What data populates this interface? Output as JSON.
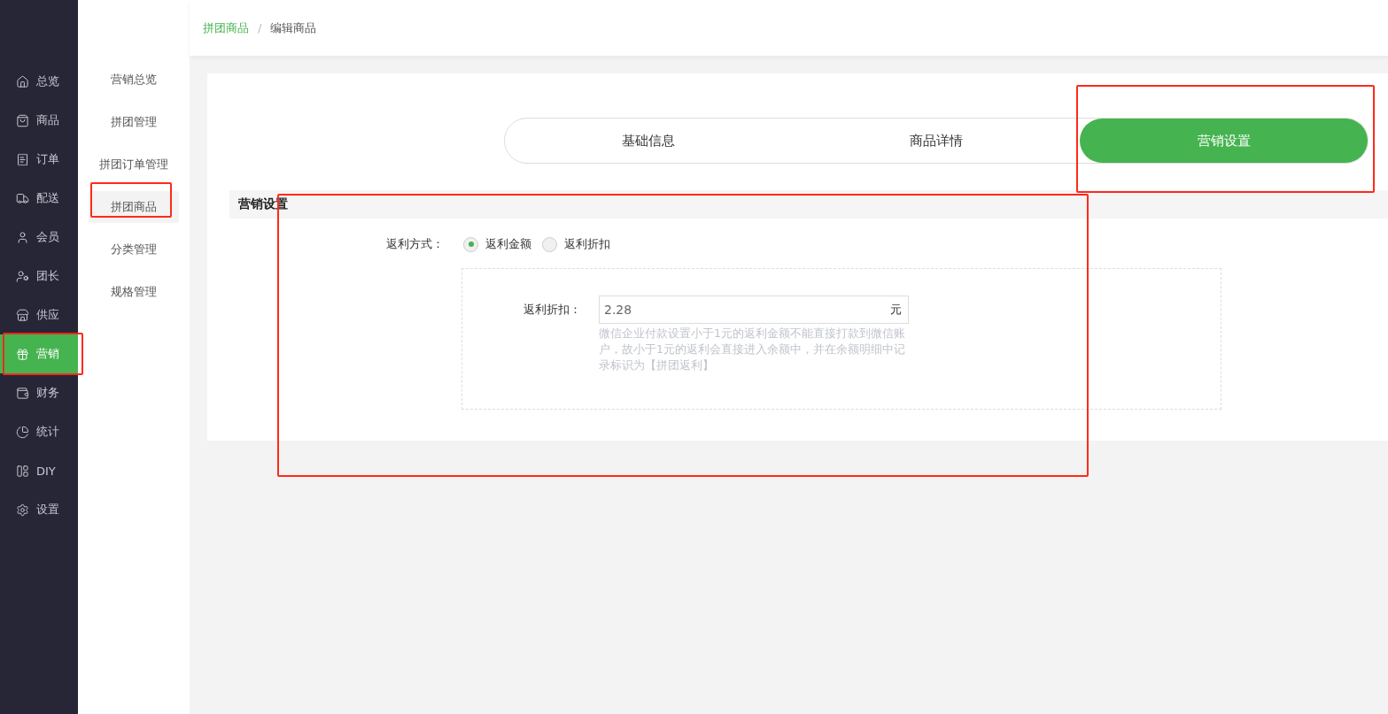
{
  "sidebar": {
    "items": [
      {
        "label": "总览",
        "selected": false,
        "highlighted": false
      },
      {
        "label": "商品",
        "selected": false,
        "highlighted": false
      },
      {
        "label": "订单",
        "selected": false,
        "highlighted": false
      },
      {
        "label": "配送",
        "selected": false,
        "highlighted": false
      },
      {
        "label": "会员",
        "selected": false,
        "highlighted": false
      },
      {
        "label": "团长",
        "selected": false,
        "highlighted": false
      },
      {
        "label": "供应",
        "selected": false,
        "highlighted": false
      },
      {
        "label": "营销",
        "selected": true,
        "highlighted": true
      },
      {
        "label": "财务",
        "selected": false,
        "highlighted": false
      },
      {
        "label": "统计",
        "selected": false,
        "highlighted": false
      },
      {
        "label": "DIY",
        "selected": false,
        "highlighted": false
      },
      {
        "label": "设置",
        "selected": false,
        "highlighted": false
      }
    ]
  },
  "subnav": {
    "items": [
      {
        "label": "营销总览",
        "selected": false,
        "highlighted": false
      },
      {
        "label": "拼团管理",
        "selected": false,
        "highlighted": false
      },
      {
        "label": "拼团订单管理",
        "selected": false,
        "highlighted": false
      },
      {
        "label": "拼团商品",
        "selected": true,
        "highlighted": true
      },
      {
        "label": "分类管理",
        "selected": false,
        "highlighted": false
      },
      {
        "label": "规格管理",
        "selected": false,
        "highlighted": false
      }
    ]
  },
  "breadcrumb": [
    {
      "label": "拼团商品",
      "kind": "link"
    },
    {
      "label": "/",
      "kind": "separator"
    },
    {
      "label": "编辑商品",
      "kind": "current"
    }
  ],
  "tabs": [
    {
      "label": "基础信息",
      "selected": false,
      "highlighted": false
    },
    {
      "label": "商品详情",
      "selected": false,
      "highlighted": false
    },
    {
      "label": "营销设置",
      "selected": true,
      "highlighted": true
    }
  ],
  "section": {
    "title": "营销设置",
    "highlighted": true,
    "rebate_mode": {
      "label": "返利方式：",
      "options": [
        {
          "label": "返利金额",
          "selected": true
        },
        {
          "label": "返利折扣",
          "selected": false
        }
      ]
    },
    "rebate_field": {
      "label": "返利折扣：",
      "value": "2.28",
      "unit": "元",
      "hint": "微信企业付款设置小于1元的返利金额不能直接打款到微信账户，故小于1元的返利会直接进入余额中，并在余额明细中记录标识为【拼团返利】"
    }
  }
}
